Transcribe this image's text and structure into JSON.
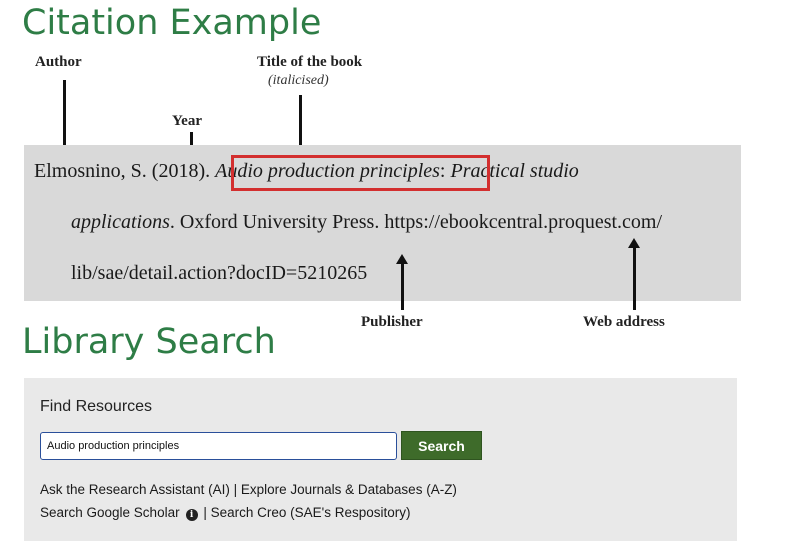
{
  "headings": {
    "citation": "Citation Example",
    "library": "Library Search"
  },
  "citation_labels": {
    "author": "Author",
    "year": "Year",
    "title": "Title of the book",
    "title_note": "(italicised)",
    "publisher": "Publisher",
    "web": "Web address"
  },
  "citation": {
    "author_year": "Elmosnino, S. (2018). ",
    "title_part1": "Audio production principles",
    "title_colon": ": ",
    "title_part2": "Practical studio",
    "title_part3": "applications",
    "after_title": ". Oxford University Press. https://ebookcentral.proquest.com/",
    "url_rest": "lib/sae/detail.action?docID=5210265"
  },
  "search": {
    "title": "Find Resources",
    "input_value": "Audio production principles",
    "button_label": "Search",
    "links_row1": {
      "research_assistant": "Ask the Research Assistant (AI)",
      "separator": " | ",
      "journals": "Explore Journals & Databases (A-Z)"
    },
    "links_row2": {
      "scholar": "Search Google Scholar",
      "info_icon": "i",
      "separator": " | ",
      "creo": "Search Creo (SAE's Respository)"
    }
  },
  "colors": {
    "heading_green": "#2e7d46",
    "highlight_red": "#d32f2f",
    "button_green": "#3e6b2a"
  }
}
